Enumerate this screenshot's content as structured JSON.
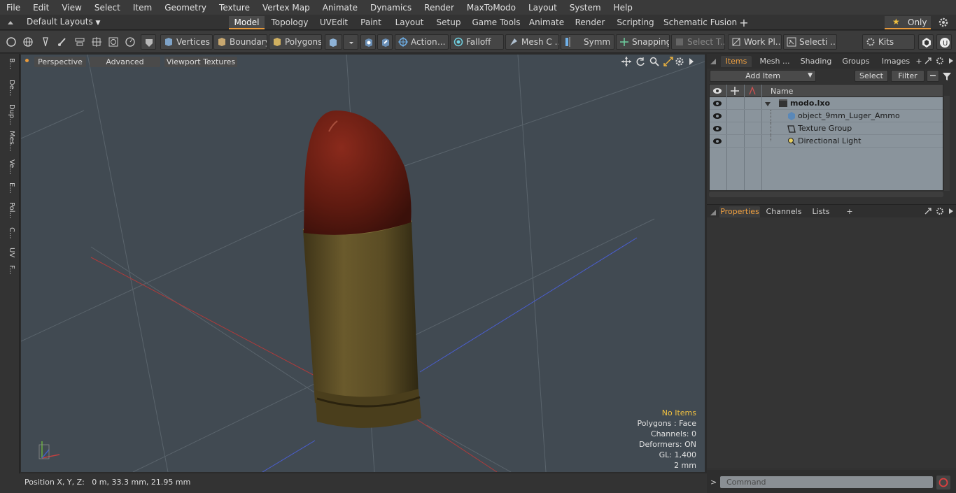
{
  "menu": [
    "File",
    "Edit",
    "View",
    "Select",
    "Item",
    "Geometry",
    "Texture",
    "Vertex Map",
    "Animate",
    "Dynamics",
    "Render",
    "MaxToModo",
    "Layout",
    "System",
    "Help"
  ],
  "layoutbar": {
    "default_layouts": "Default Layouts",
    "tabs": [
      "Model",
      "Topology",
      "UVEdit",
      "Paint",
      "Layout",
      "Setup",
      "Game Tools",
      "Animate",
      "Render",
      "Scripting",
      "Schematic Fusion"
    ],
    "active_tab": "Model",
    "plus": "+",
    "only_label": "Only"
  },
  "toolbar": {
    "vertices": "Vertices",
    "boundary": "Boundary",
    "polygons": "Polygons",
    "action": "Action",
    "falloff": "Falloff",
    "mesh_c": "Mesh C ...",
    "symm": "Symm ...",
    "snapping": "Snapping",
    "select_t": "Select T...",
    "work_pl": "Work Pl...",
    "selecti": "Selecti ...",
    "kits": "Kits",
    "ellipsis": "..."
  },
  "left_tabs": [
    "B...",
    "De...",
    "Dup...",
    "Mes...",
    "Ve...",
    "E...",
    "Pol...",
    "C...",
    "UV",
    "F..."
  ],
  "viewport": {
    "perspective": "Perspective",
    "advanced": "Advanced",
    "viewport_textures": "Viewport Textures",
    "info": {
      "no_items": "No Items",
      "polygons": "Polygons : Face",
      "channels": "Channels: 0",
      "deformers": "Deformers: ON",
      "gl": "GL: 1,400",
      "scale": "2 mm"
    }
  },
  "status": {
    "position": "Position X, Y, Z:   0 m, 33.3 mm, 21.95 mm"
  },
  "right_panel": {
    "tabs": [
      "Items",
      "Mesh ...",
      "Shading",
      "Groups",
      "Images"
    ],
    "active_tab": "Items",
    "add_item": "Add Item",
    "select": "Select",
    "filter": "Filter",
    "name_header": "Name",
    "items": [
      {
        "name": "modo.lxo",
        "bold": true,
        "icon": "scene-icon"
      },
      {
        "name": "object_9mm_Luger_Ammo",
        "bold": false,
        "icon": "mesh-icon"
      },
      {
        "name": "Texture Group",
        "bold": false,
        "icon": "texture-group-icon"
      },
      {
        "name": "Directional Light",
        "bold": false,
        "icon": "light-icon"
      }
    ],
    "bottom_tabs": [
      "Properties",
      "Channels",
      "Lists"
    ],
    "bottom_active": "Properties",
    "plus": "+",
    "command_placeholder": "Command",
    "prompt": ">"
  },
  "colors": {
    "accent": "#e89a3c",
    "viewport_bg": "#414a52",
    "items_bg": "#8a949c",
    "bullet_tip": "#6a1a12",
    "casing": "#5f5228"
  }
}
